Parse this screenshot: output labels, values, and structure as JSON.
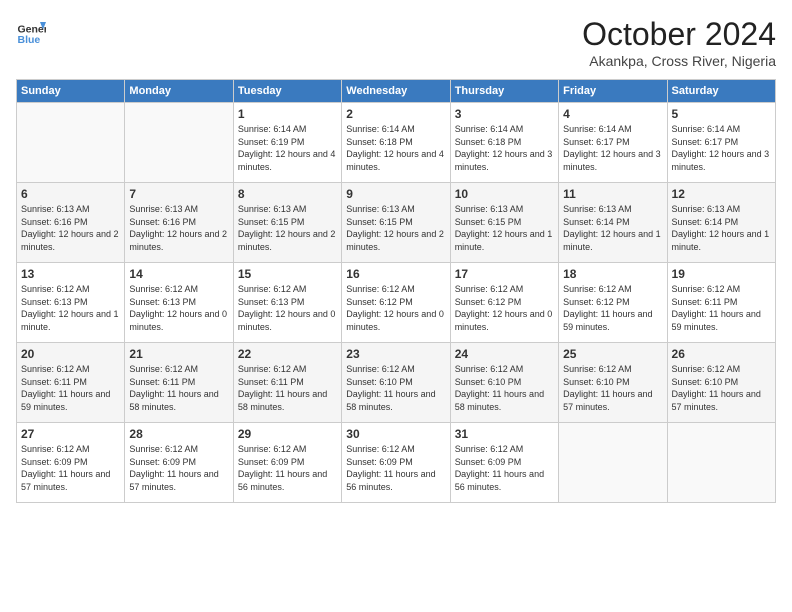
{
  "header": {
    "logo_line1": "General",
    "logo_line2": "Blue",
    "month": "October 2024",
    "location": "Akankpa, Cross River, Nigeria"
  },
  "days_of_week": [
    "Sunday",
    "Monday",
    "Tuesday",
    "Wednesday",
    "Thursday",
    "Friday",
    "Saturday"
  ],
  "weeks": [
    [
      {
        "num": "",
        "sunrise": "",
        "sunset": "",
        "daylight": ""
      },
      {
        "num": "",
        "sunrise": "",
        "sunset": "",
        "daylight": ""
      },
      {
        "num": "1",
        "sunrise": "Sunrise: 6:14 AM",
        "sunset": "Sunset: 6:19 PM",
        "daylight": "Daylight: 12 hours and 4 minutes."
      },
      {
        "num": "2",
        "sunrise": "Sunrise: 6:14 AM",
        "sunset": "Sunset: 6:18 PM",
        "daylight": "Daylight: 12 hours and 4 minutes."
      },
      {
        "num": "3",
        "sunrise": "Sunrise: 6:14 AM",
        "sunset": "Sunset: 6:18 PM",
        "daylight": "Daylight: 12 hours and 3 minutes."
      },
      {
        "num": "4",
        "sunrise": "Sunrise: 6:14 AM",
        "sunset": "Sunset: 6:17 PM",
        "daylight": "Daylight: 12 hours and 3 minutes."
      },
      {
        "num": "5",
        "sunrise": "Sunrise: 6:14 AM",
        "sunset": "Sunset: 6:17 PM",
        "daylight": "Daylight: 12 hours and 3 minutes."
      }
    ],
    [
      {
        "num": "6",
        "sunrise": "Sunrise: 6:13 AM",
        "sunset": "Sunset: 6:16 PM",
        "daylight": "Daylight: 12 hours and 2 minutes."
      },
      {
        "num": "7",
        "sunrise": "Sunrise: 6:13 AM",
        "sunset": "Sunset: 6:16 PM",
        "daylight": "Daylight: 12 hours and 2 minutes."
      },
      {
        "num": "8",
        "sunrise": "Sunrise: 6:13 AM",
        "sunset": "Sunset: 6:15 PM",
        "daylight": "Daylight: 12 hours and 2 minutes."
      },
      {
        "num": "9",
        "sunrise": "Sunrise: 6:13 AM",
        "sunset": "Sunset: 6:15 PM",
        "daylight": "Daylight: 12 hours and 2 minutes."
      },
      {
        "num": "10",
        "sunrise": "Sunrise: 6:13 AM",
        "sunset": "Sunset: 6:15 PM",
        "daylight": "Daylight: 12 hours and 1 minute."
      },
      {
        "num": "11",
        "sunrise": "Sunrise: 6:13 AM",
        "sunset": "Sunset: 6:14 PM",
        "daylight": "Daylight: 12 hours and 1 minute."
      },
      {
        "num": "12",
        "sunrise": "Sunrise: 6:13 AM",
        "sunset": "Sunset: 6:14 PM",
        "daylight": "Daylight: 12 hours and 1 minute."
      }
    ],
    [
      {
        "num": "13",
        "sunrise": "Sunrise: 6:12 AM",
        "sunset": "Sunset: 6:13 PM",
        "daylight": "Daylight: 12 hours and 1 minute."
      },
      {
        "num": "14",
        "sunrise": "Sunrise: 6:12 AM",
        "sunset": "Sunset: 6:13 PM",
        "daylight": "Daylight: 12 hours and 0 minutes."
      },
      {
        "num": "15",
        "sunrise": "Sunrise: 6:12 AM",
        "sunset": "Sunset: 6:13 PM",
        "daylight": "Daylight: 12 hours and 0 minutes."
      },
      {
        "num": "16",
        "sunrise": "Sunrise: 6:12 AM",
        "sunset": "Sunset: 6:12 PM",
        "daylight": "Daylight: 12 hours and 0 minutes."
      },
      {
        "num": "17",
        "sunrise": "Sunrise: 6:12 AM",
        "sunset": "Sunset: 6:12 PM",
        "daylight": "Daylight: 12 hours and 0 minutes."
      },
      {
        "num": "18",
        "sunrise": "Sunrise: 6:12 AM",
        "sunset": "Sunset: 6:12 PM",
        "daylight": "Daylight: 11 hours and 59 minutes."
      },
      {
        "num": "19",
        "sunrise": "Sunrise: 6:12 AM",
        "sunset": "Sunset: 6:11 PM",
        "daylight": "Daylight: 11 hours and 59 minutes."
      }
    ],
    [
      {
        "num": "20",
        "sunrise": "Sunrise: 6:12 AM",
        "sunset": "Sunset: 6:11 PM",
        "daylight": "Daylight: 11 hours and 59 minutes."
      },
      {
        "num": "21",
        "sunrise": "Sunrise: 6:12 AM",
        "sunset": "Sunset: 6:11 PM",
        "daylight": "Daylight: 11 hours and 58 minutes."
      },
      {
        "num": "22",
        "sunrise": "Sunrise: 6:12 AM",
        "sunset": "Sunset: 6:11 PM",
        "daylight": "Daylight: 11 hours and 58 minutes."
      },
      {
        "num": "23",
        "sunrise": "Sunrise: 6:12 AM",
        "sunset": "Sunset: 6:10 PM",
        "daylight": "Daylight: 11 hours and 58 minutes."
      },
      {
        "num": "24",
        "sunrise": "Sunrise: 6:12 AM",
        "sunset": "Sunset: 6:10 PM",
        "daylight": "Daylight: 11 hours and 58 minutes."
      },
      {
        "num": "25",
        "sunrise": "Sunrise: 6:12 AM",
        "sunset": "Sunset: 6:10 PM",
        "daylight": "Daylight: 11 hours and 57 minutes."
      },
      {
        "num": "26",
        "sunrise": "Sunrise: 6:12 AM",
        "sunset": "Sunset: 6:10 PM",
        "daylight": "Daylight: 11 hours and 57 minutes."
      }
    ],
    [
      {
        "num": "27",
        "sunrise": "Sunrise: 6:12 AM",
        "sunset": "Sunset: 6:09 PM",
        "daylight": "Daylight: 11 hours and 57 minutes."
      },
      {
        "num": "28",
        "sunrise": "Sunrise: 6:12 AM",
        "sunset": "Sunset: 6:09 PM",
        "daylight": "Daylight: 11 hours and 57 minutes."
      },
      {
        "num": "29",
        "sunrise": "Sunrise: 6:12 AM",
        "sunset": "Sunset: 6:09 PM",
        "daylight": "Daylight: 11 hours and 56 minutes."
      },
      {
        "num": "30",
        "sunrise": "Sunrise: 6:12 AM",
        "sunset": "Sunset: 6:09 PM",
        "daylight": "Daylight: 11 hours and 56 minutes."
      },
      {
        "num": "31",
        "sunrise": "Sunrise: 6:12 AM",
        "sunset": "Sunset: 6:09 PM",
        "daylight": "Daylight: 11 hours and 56 minutes."
      },
      {
        "num": "",
        "sunrise": "",
        "sunset": "",
        "daylight": ""
      },
      {
        "num": "",
        "sunrise": "",
        "sunset": "",
        "daylight": ""
      }
    ]
  ]
}
